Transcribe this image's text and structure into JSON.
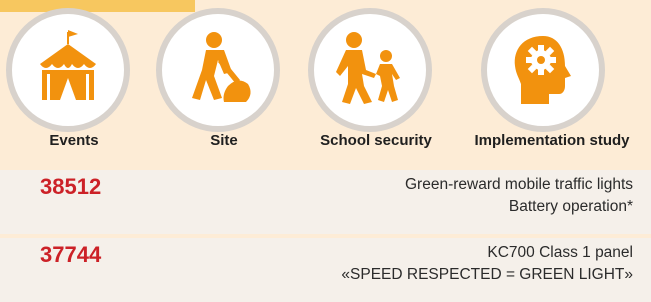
{
  "tiles": [
    {
      "label": "Events",
      "icon": "circus-tent-icon"
    },
    {
      "label": "Site",
      "icon": "construction-worker-icon"
    },
    {
      "label": "School security",
      "icon": "children-walking-icon"
    },
    {
      "label": "Implementation study",
      "icon": "head-gear-icon"
    }
  ],
  "products": [
    {
      "code": "38512",
      "line1": "Green-reward mobile traffic lights",
      "line2": "Battery operation*"
    },
    {
      "code": "37744",
      "line1": "KC700 Class 1 panel",
      "line2": "«SPEED RESPECTED = GREEN LIGHT»"
    }
  ],
  "colors": {
    "accent_orange": "#f2920e",
    "code_red": "#cc2127",
    "background": "#fdecd6",
    "row_background": "#f5f0ea",
    "circle_border": "#d8d2cc"
  }
}
